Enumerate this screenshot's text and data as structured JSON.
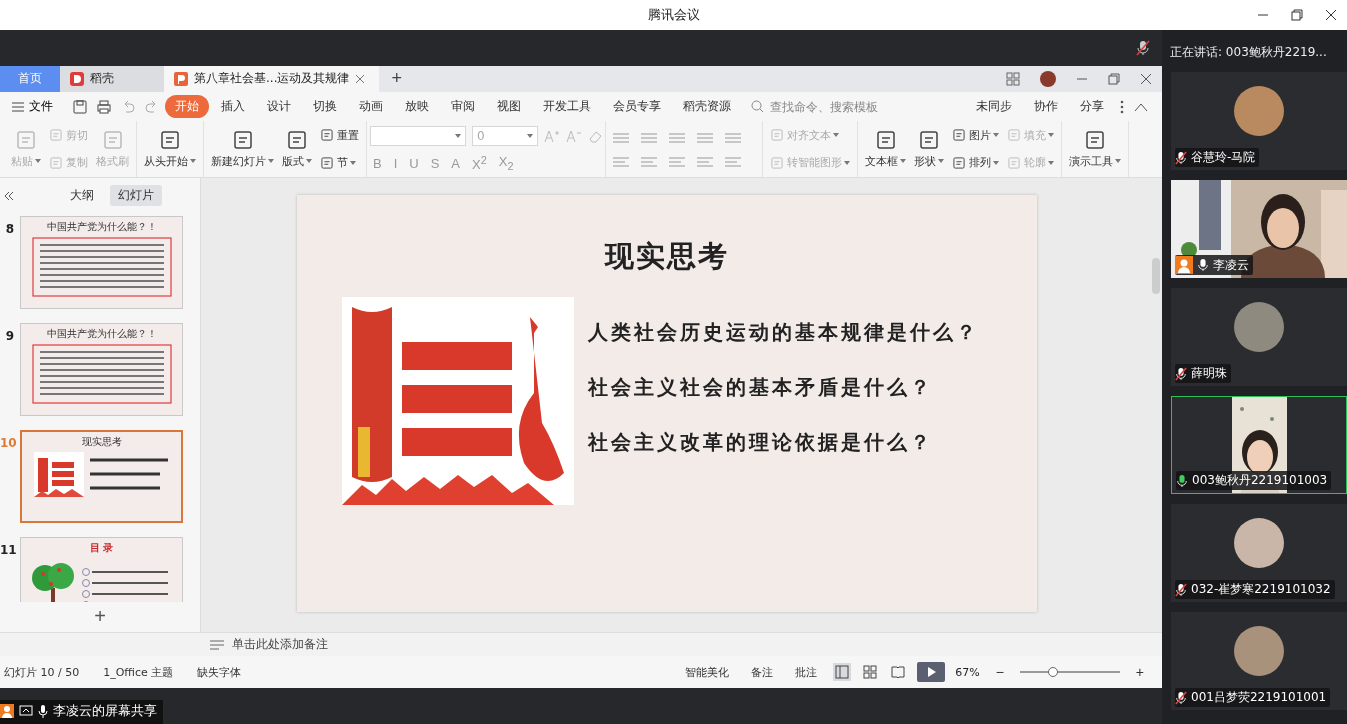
{
  "window": {
    "title": "腾讯会议"
  },
  "meeting": {
    "speaking": "正在讲话: 003鲍秋丹2219...",
    "share_label": "李凌云的屏幕共享"
  },
  "wps": {
    "tabs": [
      {
        "label": "首页",
        "kind": "home",
        "selected": false
      },
      {
        "label": "稻壳",
        "kind": "docer",
        "selected": false
      },
      {
        "label": "第八章社会基...运动及其规律",
        "kind": "doc",
        "selected": true
      }
    ],
    "new_tab": "+",
    "menu": {
      "file": "文件",
      "tabs": [
        {
          "label": "开始",
          "selected": true
        },
        {
          "label": "插入",
          "selected": false
        },
        {
          "label": "设计",
          "selected": false
        },
        {
          "label": "切换",
          "selected": false
        },
        {
          "label": "动画",
          "selected": false
        },
        {
          "label": "放映",
          "selected": false
        },
        {
          "label": "审阅",
          "selected": false
        },
        {
          "label": "视图",
          "selected": false
        },
        {
          "label": "开发工具",
          "selected": false
        },
        {
          "label": "会员专享",
          "selected": false
        },
        {
          "label": "稻壳资源",
          "selected": false
        }
      ],
      "search": {
        "placeholder": "查找命令、搜索模板"
      },
      "actions": [
        "未同步",
        "协作",
        "分享"
      ]
    },
    "ribbon": [
      {
        "kind": "tools",
        "columns": [
          [
            {
              "label": "粘贴",
              "disabled": true,
              "dropdown": true
            }
          ],
          [
            {
              "label": "剪切",
              "disabled": true,
              "dropdown": false
            },
            {
              "label": "复制",
              "disabled": true,
              "dropdown": false
            }
          ],
          [
            {
              "label": "格式刷",
              "disabled": true,
              "dropdown": false
            }
          ]
        ]
      },
      {
        "kind": "tools",
        "columns": [
          [
            {
              "label": "从头开始",
              "disabled": false,
              "dropdown": true
            }
          ]
        ]
      },
      {
        "kind": "tools",
        "columns": [
          [
            {
              "label": "新建幻灯片",
              "disabled": false,
              "dropdown": true
            }
          ],
          [
            {
              "label": "版式",
              "disabled": false,
              "dropdown": true
            }
          ],
          [
            {
              "label": "重置",
              "disabled": false,
              "dropdown": false
            },
            {
              "label": "节",
              "disabled": false,
              "dropdown": true
            }
          ]
        ]
      },
      {
        "kind": "font",
        "size": "0",
        "formats": [
          "B",
          "I",
          "U",
          "S",
          "A",
          "X$^{2}$",
          "X$_{2}$"
        ]
      },
      {
        "kind": "paragraph"
      },
      {
        "kind": "tools",
        "columns": [
          [
            {
              "label": "对齐文本",
              "disabled": true,
              "dropdown": true
            },
            {
              "label": "转智能图形",
              "disabled": true,
              "dropdown": true
            }
          ]
        ]
      },
      {
        "kind": "tools",
        "columns": [
          [
            {
              "label": "文本框",
              "disabled": false,
              "dropdown": true
            }
          ],
          [
            {
              "label": "形状",
              "disabled": false,
              "dropdown": true
            }
          ],
          [
            {
              "label": "图片",
              "disabled": false,
              "dropdown": true
            },
            {
              "label": "排列",
              "disabled": false,
              "dropdown": true
            }
          ],
          [
            {
              "label": "填充",
              "disabled": true,
              "dropdown": true
            },
            {
              "label": "轮廓",
              "disabled": true,
              "dropdown": true
            }
          ]
        ]
      },
      {
        "kind": "tools",
        "columns": [
          [
            {
              "label": "演示工具",
              "disabled": false,
              "dropdown": true
            }
          ]
        ]
      }
    ],
    "sidebar": {
      "tabs": [
        {
          "label": "大纲",
          "selected": false
        },
        {
          "label": "幻灯片",
          "selected": true
        }
      ],
      "slides": [
        {
          "number": "8",
          "title": "中国共产党为什么能？！",
          "kind": "text",
          "selected": false
        },
        {
          "number": "9",
          "title": "中国共产党为什么能？！",
          "kind": "text",
          "selected": false
        },
        {
          "number": "10",
          "title": "现实思考",
          "kind": "questions",
          "selected": true
        },
        {
          "number": "11",
          "title": "目 录",
          "kind": "contents",
          "selected": false
        }
      ],
      "add": "+"
    },
    "slide": {
      "title": "现实思考",
      "questions": [
        "人类社会历史运动的基本规律是什么？",
        "社会主义社会的基本矛盾是什么？",
        "社会主义改革的理论依据是什么？"
      ]
    },
    "notes": {
      "placeholder": "单击此处添加备注"
    },
    "status_bar": {
      "items": [
        "幻灯片 10 / 50",
        "1_Office 主题",
        "缺失字体"
      ],
      "actions": [
        "智能美化",
        "备注",
        "批注"
      ],
      "views": [
        {
          "kind": "normal",
          "selected": true
        },
        {
          "kind": "sorter",
          "selected": false
        },
        {
          "kind": "reading",
          "selected": false
        }
      ],
      "zoom": "67%",
      "zoom_out": "−",
      "zoom_in": "+",
      "zoom_slider": {
        "level": 0.33
      }
    }
  },
  "participants": [
    {
      "name": "谷慧玲-马院",
      "kind": "avatar",
      "muted": true,
      "speaking": false,
      "host": false,
      "color": "#b98a60"
    },
    {
      "name": "李凌云",
      "kind": "video",
      "muted": false,
      "speaking": false,
      "host": true,
      "color": "#c9b8a6"
    },
    {
      "name": "薛明珠",
      "kind": "avatar",
      "muted": true,
      "speaking": false,
      "host": false,
      "color": "#8f8a80"
    },
    {
      "name": "003鲍秋丹2219101003",
      "kind": "portrait_video",
      "muted": false,
      "speaking": true,
      "host": false,
      "color": "#e8e2d6"
    },
    {
      "name": "032-崔梦寒2219101032",
      "kind": "avatar",
      "muted": true,
      "speaking": false,
      "host": false,
      "color": "#c9b6a8"
    },
    {
      "name": "001吕梦荧2219101001",
      "kind": "avatar",
      "muted": true,
      "speaking": false,
      "host": false,
      "color": "#a8927c"
    }
  ]
}
